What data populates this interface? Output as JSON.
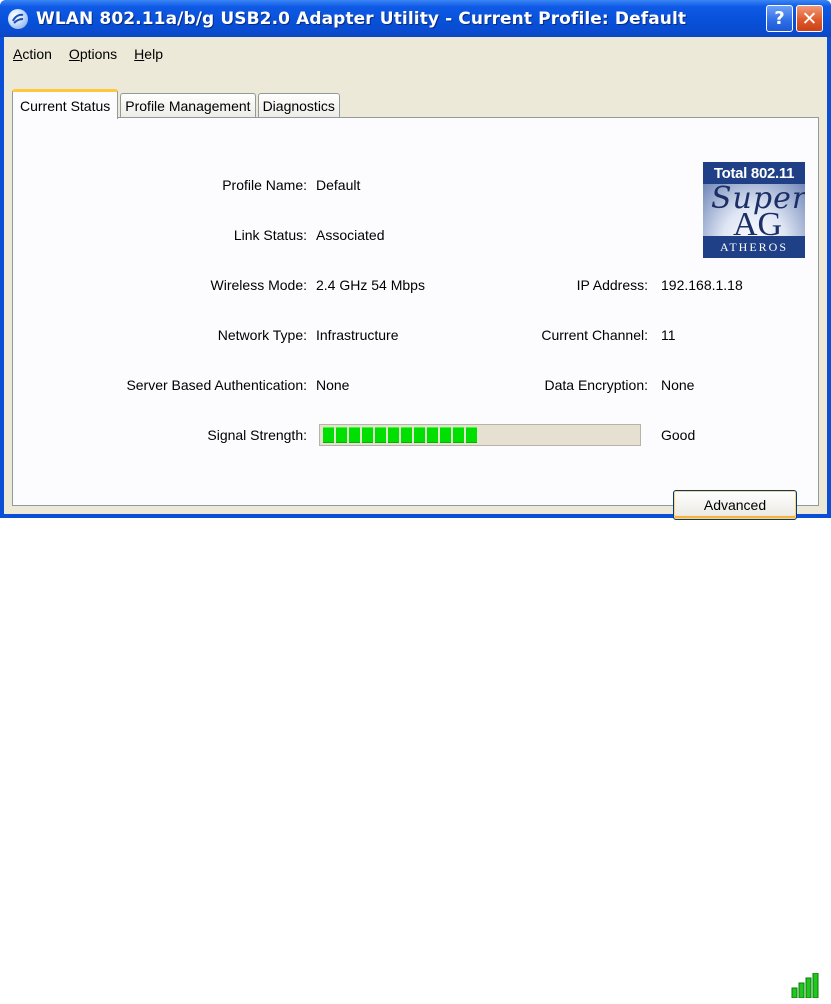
{
  "window": {
    "title": "WLAN 802.11a/b/g USB2.0 Adapter Utility - Current Profile: Default",
    "help_glyph": "?",
    "close_glyph": "✕"
  },
  "menu": {
    "items": [
      {
        "label": "Action",
        "mnemonic": "A"
      },
      {
        "label": "Options",
        "mnemonic": "O"
      },
      {
        "label": "Help",
        "mnemonic": "H"
      }
    ]
  },
  "tabs": [
    {
      "label": "Current Status",
      "active": true
    },
    {
      "label": "Profile Management",
      "active": false
    },
    {
      "label": "Diagnostics",
      "active": false
    }
  ],
  "status": {
    "profile_name_label": "Profile Name:",
    "profile_name": "Default",
    "link_status_label": "Link Status:",
    "link_status": "Associated",
    "wireless_mode_label": "Wireless Mode:",
    "wireless_mode": "2.4 GHz 54 Mbps",
    "network_type_label": "Network Type:",
    "network_type": "Infrastructure",
    "server_auth_label": "Server Based Authentication:",
    "server_auth": "None",
    "ip_address_label": "IP Address:",
    "ip_address": "192.168.1.18",
    "current_channel_label": "Current Channel:",
    "current_channel": "11",
    "data_encryption_label": "Data Encryption:",
    "data_encryption": "None",
    "signal_strength_label": "Signal Strength:",
    "signal_strength_text": "Good",
    "signal_strength_fraction": 0.5
  },
  "logo": {
    "top_text": "Total 802.11",
    "super_text": "Super",
    "ag_text": "AG",
    "bottom_text": "ATHEROS"
  },
  "buttons": {
    "advanced": "Advanced"
  },
  "colors": {
    "title_bar": "#0a4fd6",
    "dialog_bg": "#ece9d8",
    "signal_green": "#00e000",
    "tab_highlight": "#ffc83c"
  },
  "icons": {
    "app": "wireless-globe-icon",
    "tray": "signal-bars-icon"
  }
}
